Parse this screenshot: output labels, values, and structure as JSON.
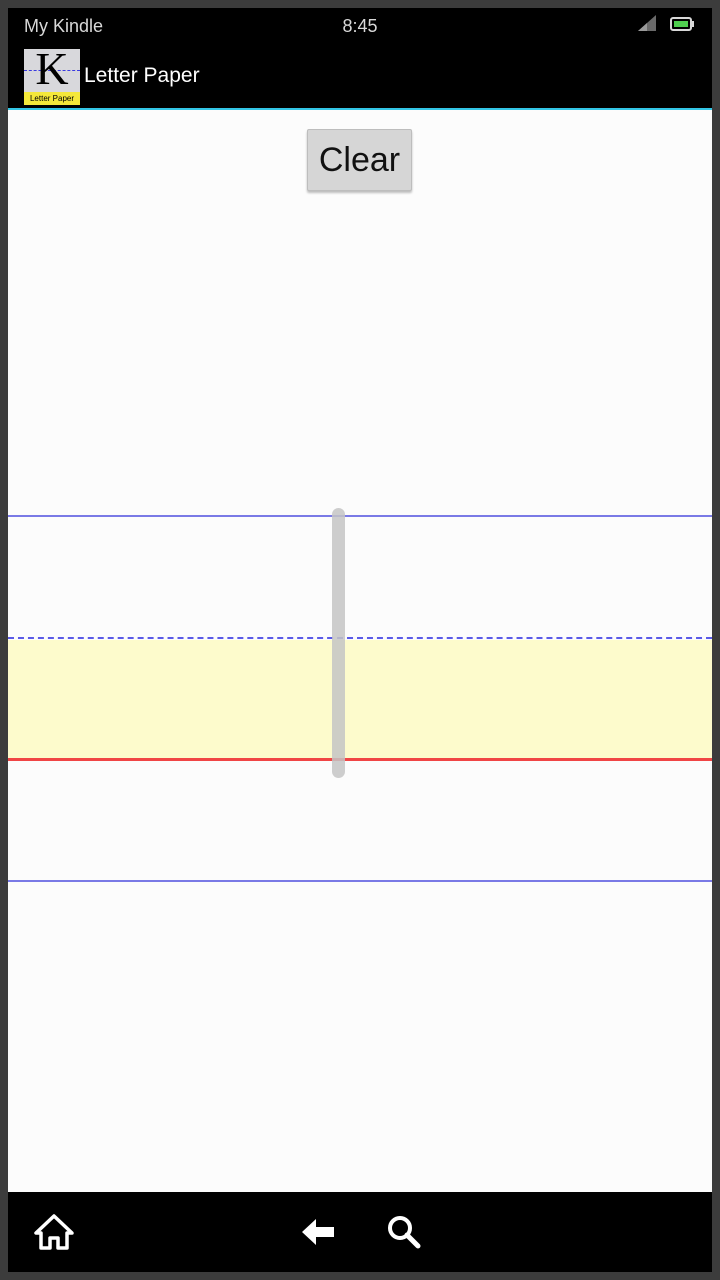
{
  "status_bar": {
    "carrier": "My Kindle",
    "time": "8:45",
    "icons": [
      "signal-icon",
      "battery-icon"
    ]
  },
  "action_bar": {
    "app_icon": {
      "letter": "K",
      "caption": "Letter Paper"
    },
    "title": "Letter Paper"
  },
  "content": {
    "clear_label": "Clear",
    "colors": {
      "guide_line": "#7a7ae6",
      "midline": "#5a5ae8",
      "baseline": "#f04545",
      "highlight_band": "#fdfbcc"
    }
  },
  "nav_bar": {
    "icons": [
      "home-icon",
      "back-arrow-icon",
      "search-icon"
    ]
  }
}
